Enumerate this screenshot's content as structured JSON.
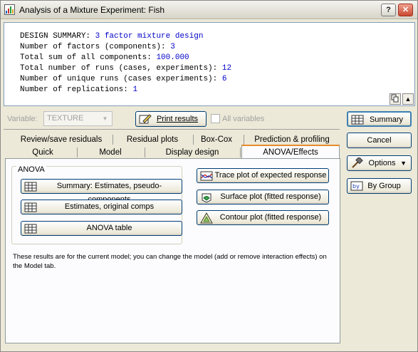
{
  "window": {
    "title": "Analysis of a Mixture Experiment: Fish",
    "help_glyph": "?",
    "close_glyph": "✕"
  },
  "results": {
    "lines": [
      {
        "label": "DESIGN SUMMARY: ",
        "value": "3 factor mixture design"
      },
      {
        "label": "Number of factors (components): ",
        "value": "3"
      },
      {
        "label": "Total sum of all components: ",
        "value": "100.000"
      },
      {
        "label": "Total number of runs (cases, experiments): ",
        "value": "12"
      },
      {
        "label": "Number of unique runs (cases experiments): ",
        "value": "6"
      },
      {
        "label": "Number of replications: ",
        "value": "1"
      }
    ]
  },
  "toolbar": {
    "variable_label": "Variable:",
    "variable_value": "TEXTURE",
    "print_results": "Print results",
    "all_variables": "All variables"
  },
  "tabs": {
    "row1": [
      "Review/save residuals",
      "Residual plots",
      "Box-Cox",
      "Prediction & profiling"
    ],
    "row2": [
      "Quick",
      "Model",
      "Display design",
      "ANOVA/Effects"
    ],
    "active": "ANOVA/Effects"
  },
  "anova": {
    "group_title": "ANOVA",
    "summary_estimates": "Summary:  Estimates, pseudo-components",
    "estimates_original": "Estimates, original comps",
    "anova_table": "ANOVA table",
    "trace_plot": "Trace plot of expected response",
    "surface_plot": "Surface plot (fitted response)",
    "contour_plot": "Contour plot (fitted response)",
    "note": "These results are for the current model; you can change the model (add or remove interaction effects) on the Model tab."
  },
  "side": {
    "summary": "Summary",
    "cancel": "Cancel",
    "options": "Options",
    "by_group": "By Group"
  },
  "colors": {
    "value_text": "#0000c8",
    "window_bg": "#ece9d8",
    "panel_bg": "#fcfcfe",
    "button_border": "#003c74"
  }
}
